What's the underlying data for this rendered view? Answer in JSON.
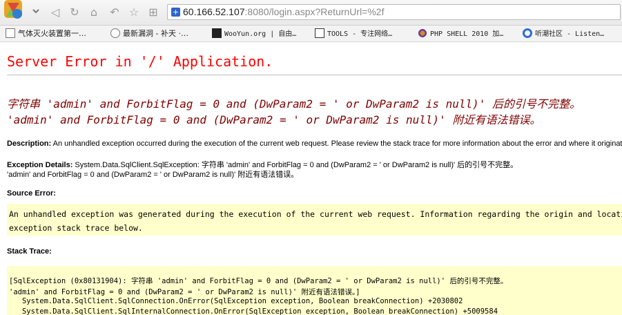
{
  "browser": {
    "url_host": "60.166.52.107",
    "url_rest": ":8080/login.aspx?ReturnUrl=%2f",
    "bookmarks": [
      {
        "label": "气体灭火装置第一…",
        "icon": "page-icon"
      },
      {
        "label": "最新漏洞 - 补天 ·…",
        "icon": "gear-icon"
      },
      {
        "label": "WooYun.org | 自由…",
        "icon": "wooyun-icon"
      },
      {
        "label": "TOOLS - 专注网络…",
        "icon": "tools-icon"
      },
      {
        "label": "PHP SHELL 2010 加…",
        "icon": "flower-icon"
      },
      {
        "label": "听潮社区 - Listen…",
        "icon": "refresh-icon"
      }
    ]
  },
  "page": {
    "title": "Server Error in '/' Application.",
    "error_line1": "字符串 'admin' and ForbitFlag = 0 and (DwParam2 = ' or DwParam2 is null)' 后的引号不完整。",
    "error_line2": "'admin' and ForbitFlag = 0 and (DwParam2 = ' or DwParam2 is null)' 附近有语法错误。",
    "description_label": "Description:",
    "description_text": " An unhandled exception occurred during the execution of the current web request. Please review the stack trace for more information about the error and where it originated in the code.",
    "exception_label": "Exception Details:",
    "exception_text": " System.Data.SqlClient.SqlException: 字符串 'admin' and ForbitFlag = 0 and (DwParam2 = ' or DwParam2 is null)' 后的引号不完整。",
    "exception_text2": "'admin' and ForbitFlag = 0 and (DwParam2 = ' or DwParam2 is null)' 附近有语法错误。",
    "source_error_label": "Source Error:",
    "source_error_line1": "An unhandled exception was generated during the execution of the current web request. Information regarding the origin and location of the",
    "source_error_line2": "exception stack trace below.",
    "stack_trace_label": "Stack Trace:",
    "stack_lines": [
      "[SqlException (0x80131904): 字符串 'admin' and ForbitFlag = 0 and (DwParam2 = ' or DwParam2 is null)' 后的引号不完整。",
      "'admin' and ForbitFlag = 0 and (DwParam2 = ' or DwParam2 is null)' 附近有语法错误。]",
      "   System.Data.SqlClient.SqlConnection.OnError(SqlException exception, Boolean breakConnection) +2030802",
      "   System.Data.SqlClient.SqlInternalConnection.OnError(SqlException exception, Boolean breakConnection) +5009584"
    ]
  }
}
